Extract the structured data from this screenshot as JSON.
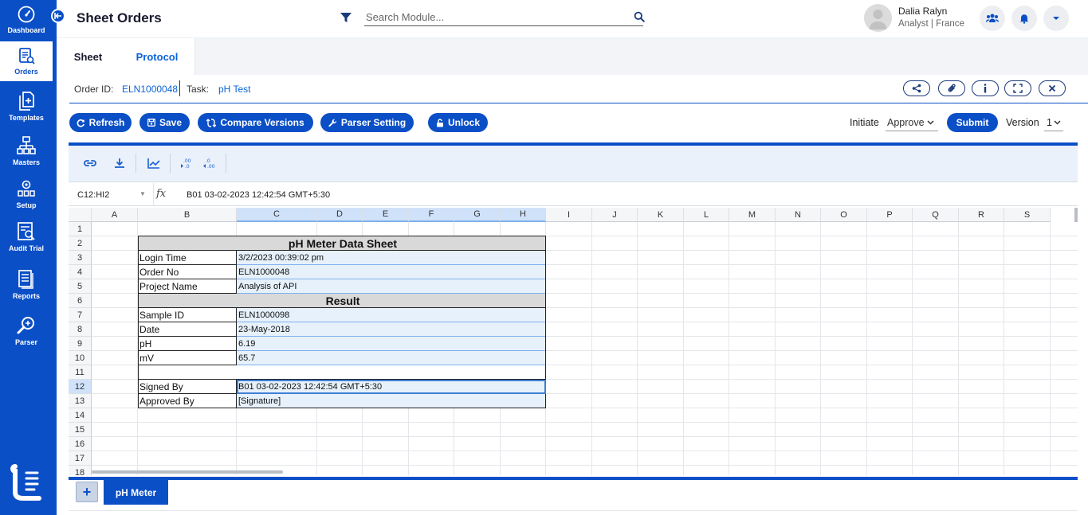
{
  "sidebar": {
    "items": [
      {
        "label": "Dashboard",
        "icon": "dashboard-icon"
      },
      {
        "label": "Orders",
        "icon": "orders-icon"
      },
      {
        "label": "Templates",
        "icon": "templates-icon"
      },
      {
        "label": "Masters",
        "icon": "masters-icon"
      },
      {
        "label": "Setup",
        "icon": "setup-icon"
      },
      {
        "label": "Audit Trial",
        "icon": "audit-trail-icon"
      },
      {
        "label": "Reports",
        "icon": "reports-icon"
      },
      {
        "label": "Parser",
        "icon": "parser-icon"
      }
    ],
    "active": "Orders"
  },
  "header": {
    "title": "Sheet Orders",
    "search_placeholder": "Search Module...",
    "user_name": "Dalia Ralyn",
    "user_role": "Analyst | France"
  },
  "tabs": [
    {
      "label": "Sheet",
      "active": true
    },
    {
      "label": "Protocol",
      "active": false
    }
  ],
  "order": {
    "order_id_label": "Order ID:",
    "order_id": "ELN1000048",
    "task_label": "Task:",
    "task": "pH Test"
  },
  "actions": {
    "refresh": "Refresh",
    "save": "Save",
    "compare_versions": "Compare Versions",
    "parser_setting": "Parser Setting",
    "unlock": "Unlock",
    "initiate_label": "Initiate",
    "approve_value": "Approve",
    "submit": "Submit",
    "version_label": "Version",
    "version_value": "1"
  },
  "sheet": {
    "name_box": "C12:HI2",
    "fx": "fx",
    "formula": "B01 03-02-2023 12:42:54 GMT+5:30",
    "columns": [
      "A",
      "B",
      "C",
      "D",
      "E",
      "F",
      "G",
      "H",
      "I",
      "J",
      "K",
      "L",
      "M",
      "N",
      "O",
      "P",
      "Q",
      "R",
      "S"
    ],
    "rows": [
      "1",
      "2",
      "3",
      "4",
      "5",
      "6",
      "7",
      "8",
      "9",
      "10",
      "11",
      "12",
      "13",
      "14",
      "15",
      "16",
      "17",
      "18"
    ],
    "title": "pH Meter Data Sheet",
    "result_heading": "Result",
    "fields": [
      {
        "label": "Login Time",
        "value": "3/2/2023 00:39:02 pm"
      },
      {
        "label": "Order No",
        "value": "ELN1000048"
      },
      {
        "label": "Project Name",
        "value": "Analysis of API"
      },
      {
        "label": "Sample ID",
        "value": "ELN1000098"
      },
      {
        "label": "Date",
        "value": "23-May-2018"
      },
      {
        "label": "pH",
        "value": "6.19"
      },
      {
        "label": "mV",
        "value": "65.7"
      },
      {
        "label": "Signed By",
        "value": "B01 03-02-2023 12:42:54 GMT+5:30"
      },
      {
        "label": "Approved By",
        "value": "[Signature]"
      }
    ],
    "tab_add": "+",
    "sheet_tab": "pH Meter"
  },
  "colors": {
    "primary": "#0b4fc7",
    "link": "#0b63d6",
    "selection": "#cfe2fa"
  }
}
